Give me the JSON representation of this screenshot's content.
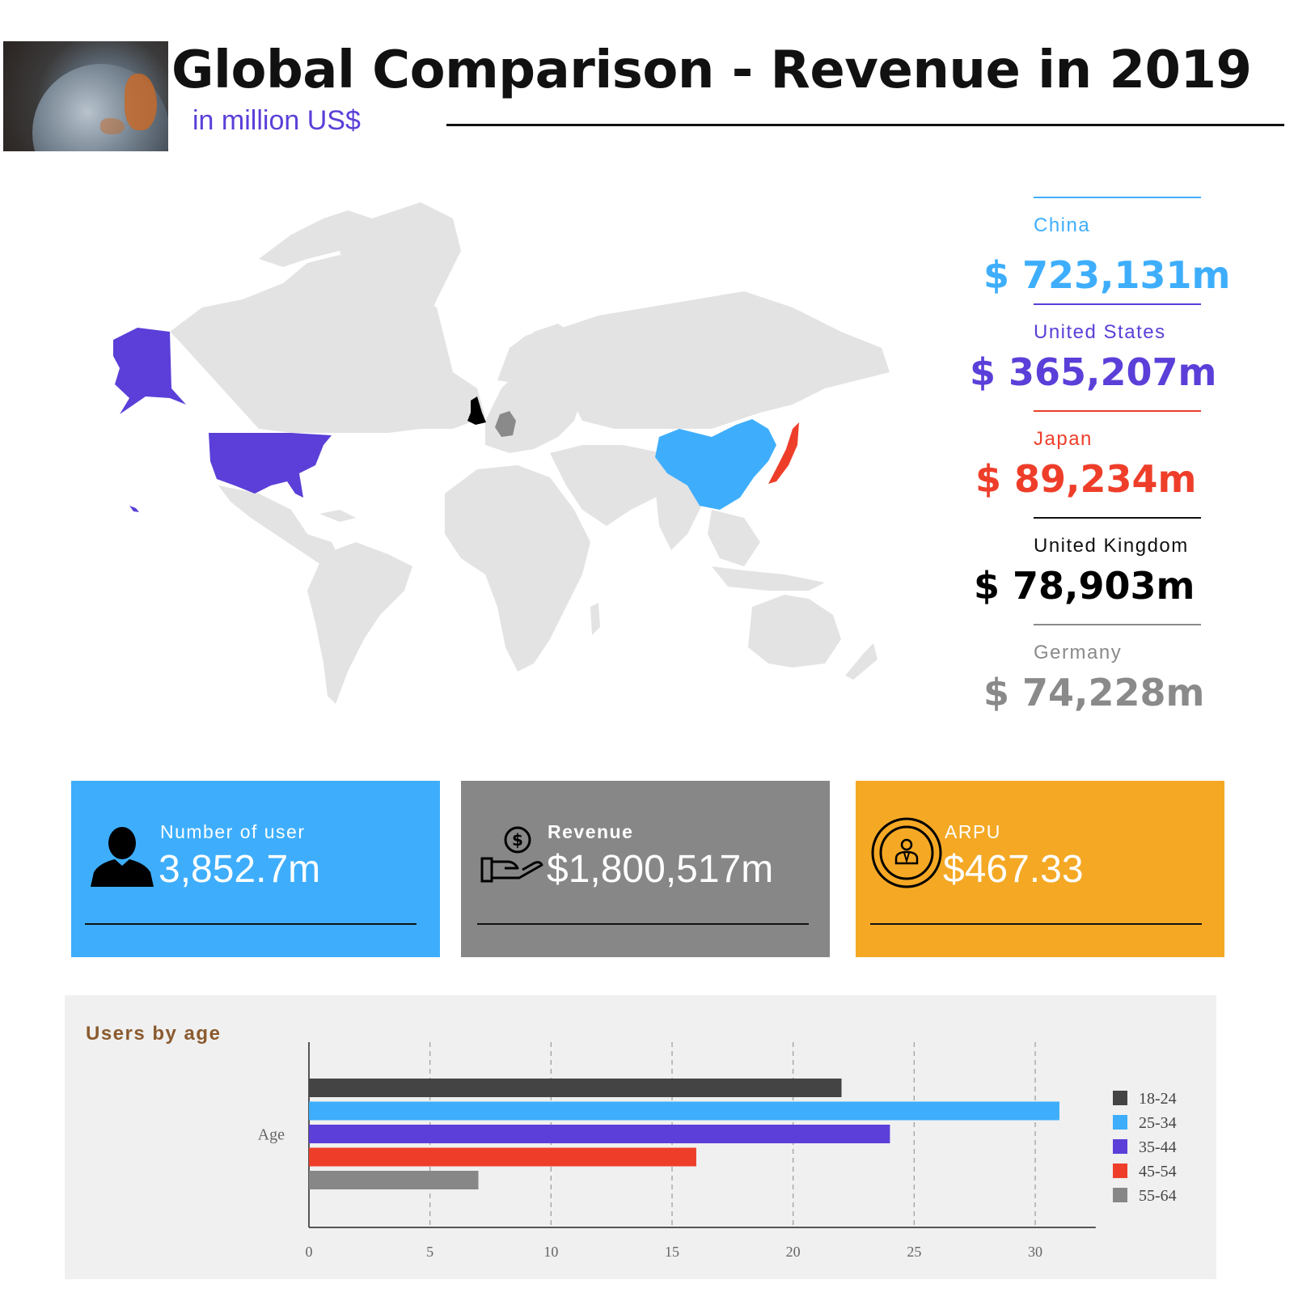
{
  "header": {
    "title": "Global Comparison - Revenue in 2019",
    "subtitle": "in million US$"
  },
  "map": {
    "highlighted": [
      {
        "country": "China",
        "color": "#3eaefc"
      },
      {
        "country": "United States",
        "color": "#5b3fd8"
      },
      {
        "country": "Japan",
        "color": "#ee3e2a"
      },
      {
        "country": "United Kingdom",
        "color": "#000000"
      },
      {
        "country": "Germany",
        "color": "#8a8a8a"
      }
    ],
    "base_color": "#e3e3e3"
  },
  "countries": [
    {
      "name": "China",
      "value": "$ 723,131m",
      "color": "#3eaefc"
    },
    {
      "name": "United States",
      "value": "$ 365,207m",
      "color": "#5b3fd8"
    },
    {
      "name": "Japan",
      "value": "$ 89,234m",
      "color": "#ee3e2a"
    },
    {
      "name": "United Kingdom",
      "value": "$ 78,903m",
      "color": "#000000"
    },
    {
      "name": "Germany",
      "value": "$ 74,228m",
      "color": "#8a8a8a"
    }
  ],
  "kpis": [
    {
      "label": "Number of user",
      "value": "3,852.7m",
      "bg": "#3eaefc",
      "icon": "user-icon"
    },
    {
      "label": "Revenue",
      "value": "$1,800,517m",
      "bg": "#878787",
      "icon": "money-hand-icon"
    },
    {
      "label": "ARPU",
      "value": "$467.33",
      "bg": "#f4a824",
      "icon": "person-badge-icon"
    }
  ],
  "chart_data": {
    "type": "bar",
    "orientation": "horizontal",
    "title": "Users by age",
    "categories": [
      "Age"
    ],
    "ylabel": "",
    "xlabel": "",
    "xlim": [
      0,
      32.5
    ],
    "xticks": [
      0,
      5,
      10,
      15,
      20,
      25,
      30
    ],
    "grid": "vertical dashed",
    "legend": "right",
    "series": [
      {
        "name": "18-24",
        "values": [
          22
        ],
        "color": "#444444"
      },
      {
        "name": "25-34",
        "values": [
          31
        ],
        "color": "#3eaefc"
      },
      {
        "name": "35-44",
        "values": [
          24
        ],
        "color": "#5b3fd8"
      },
      {
        "name": "45-54",
        "values": [
          16
        ],
        "color": "#ee3e2a"
      },
      {
        "name": "55-64",
        "values": [
          7
        ],
        "color": "#878787"
      }
    ]
  }
}
